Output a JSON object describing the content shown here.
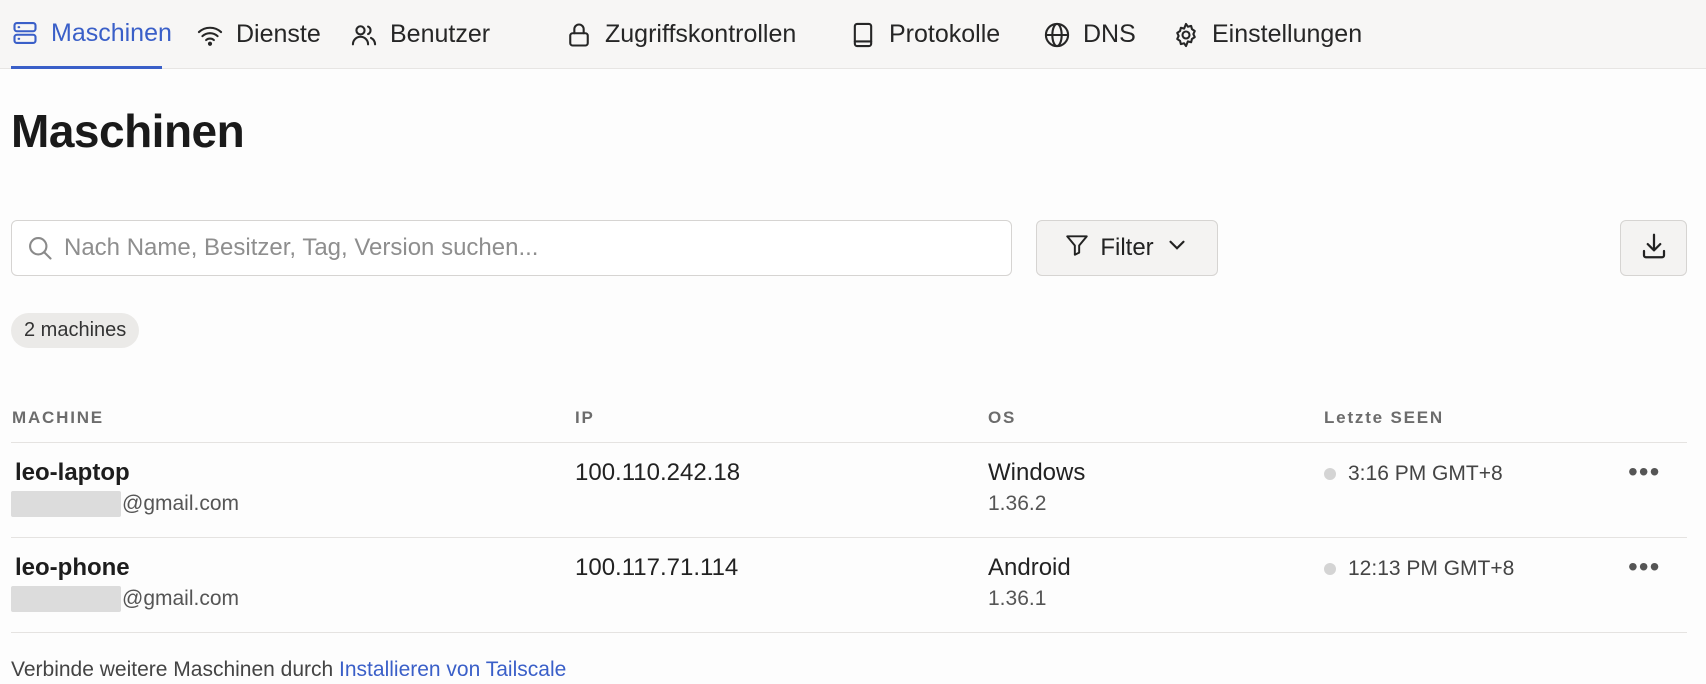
{
  "nav": {
    "items": [
      {
        "label": "Maschinen",
        "icon": "server-icon",
        "active": true
      },
      {
        "label": "Dienste",
        "icon": "wifi-icon"
      },
      {
        "label": "Benutzer",
        "icon": "users-icon"
      },
      {
        "label": "Zugriffskontrollen",
        "icon": "lock-icon"
      },
      {
        "label": "Protokolle",
        "icon": "book-icon"
      },
      {
        "label": "DNS",
        "icon": "globe-icon"
      },
      {
        "label": "Einstellungen",
        "icon": "gear-icon"
      }
    ],
    "accent_color": "#3a5fc8"
  },
  "page": {
    "title": "Maschinen"
  },
  "toolbar": {
    "search_placeholder": "Nach Name, Besitzer, Tag, Version suchen...",
    "search_value": "",
    "filter_label": "Filter",
    "download_icon": "download-icon"
  },
  "summary": {
    "count_label": "2 machines"
  },
  "table": {
    "headers": {
      "machine": "MACHINE",
      "ip": "IP",
      "os": "OS",
      "last_seen": "Letzte SEEN"
    },
    "rows": [
      {
        "name": "leo-laptop",
        "owner_suffix": "@gmail.com",
        "ip": "100.110.242.18",
        "os": "Windows",
        "version": "1.36.2",
        "last_seen": "3:16 PM GMT+8",
        "more": "•••"
      },
      {
        "name": "leo-phone",
        "owner_suffix": "@gmail.com",
        "ip": "100.117.71.114",
        "os": "Android",
        "version": "1.36.1",
        "last_seen": "12:13 PM GMT+8",
        "more": "•••"
      }
    ]
  },
  "footer": {
    "text": "Verbinde weitere Maschinen durch",
    "link_label": "Installieren von Tailscale"
  }
}
